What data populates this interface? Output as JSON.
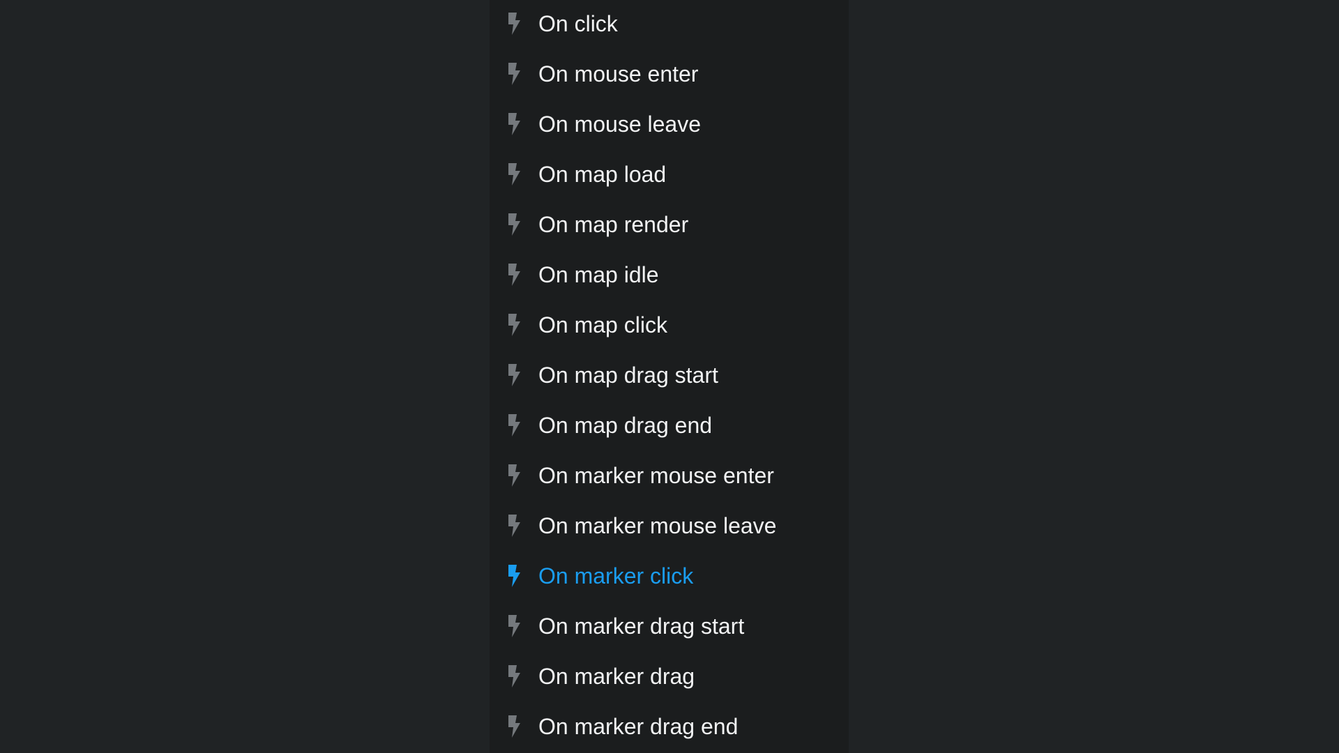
{
  "events_menu": {
    "active_index": 11,
    "accent_color": "#1a9df0",
    "icon": "lightning-bolt-icon",
    "items": [
      {
        "label": "On click"
      },
      {
        "label": "On mouse enter"
      },
      {
        "label": "On mouse leave"
      },
      {
        "label": "On map load"
      },
      {
        "label": "On map render"
      },
      {
        "label": "On map idle"
      },
      {
        "label": "On map click"
      },
      {
        "label": "On map drag start"
      },
      {
        "label": "On map drag end"
      },
      {
        "label": "On marker mouse enter"
      },
      {
        "label": "On marker mouse leave"
      },
      {
        "label": "On marker click"
      },
      {
        "label": "On marker drag start"
      },
      {
        "label": "On marker drag"
      },
      {
        "label": "On marker drag end"
      }
    ]
  }
}
